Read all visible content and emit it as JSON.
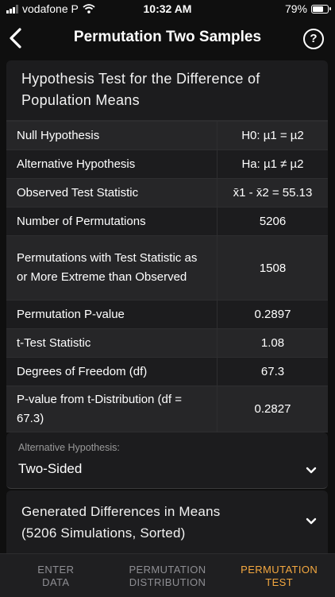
{
  "status": {
    "carrier": "vodafone P",
    "time": "10:32 AM",
    "battery": "79%",
    "battery_level": 0.79
  },
  "nav": {
    "title": "Permutation Two Samples",
    "help_label": "?"
  },
  "results": {
    "title_line1": "Hypothesis Test for the Difference of",
    "title_line2": "Population Means",
    "rows": [
      {
        "label": "Null Hypothesis",
        "value": "H0: µ1 = µ2"
      },
      {
        "label": "Alternative Hypothesis",
        "value": "Ha: µ1 ≠ µ2"
      },
      {
        "label": "Observed Test Statistic",
        "value": "x̄1 - x̄2 = 55.13"
      },
      {
        "label": "Number of Permutations",
        "value": "5206"
      },
      {
        "label": "Permutations with Test Statistic as or More Extreme than Observed",
        "value": "1508"
      },
      {
        "label": "Permutation P-value",
        "value": "0.2897"
      },
      {
        "label": "t-Test Statistic",
        "value": "1.08"
      },
      {
        "label": "Degrees of Freedom (df)",
        "value": "67.3"
      },
      {
        "label": "P-value from t-Distribution (df = 67.3)",
        "value": "0.2827"
      }
    ]
  },
  "alternative": {
    "label": "Alternative Hypothesis:",
    "value": "Two-Sided"
  },
  "generated": {
    "line1": "Generated Differences in Means",
    "line2": "(5206 Simulations, Sorted)"
  },
  "tabs": [
    {
      "line1": "ENTER",
      "line2": "DATA",
      "active": false
    },
    {
      "line1": "PERMUTATION",
      "line2": "DISTRIBUTION",
      "active": false
    },
    {
      "line1": "PERMUTATION",
      "line2": "TEST",
      "active": true
    }
  ],
  "colors": {
    "accent": "#f4a840",
    "background": "#0f0f0f",
    "card": "#1c1c1e"
  }
}
